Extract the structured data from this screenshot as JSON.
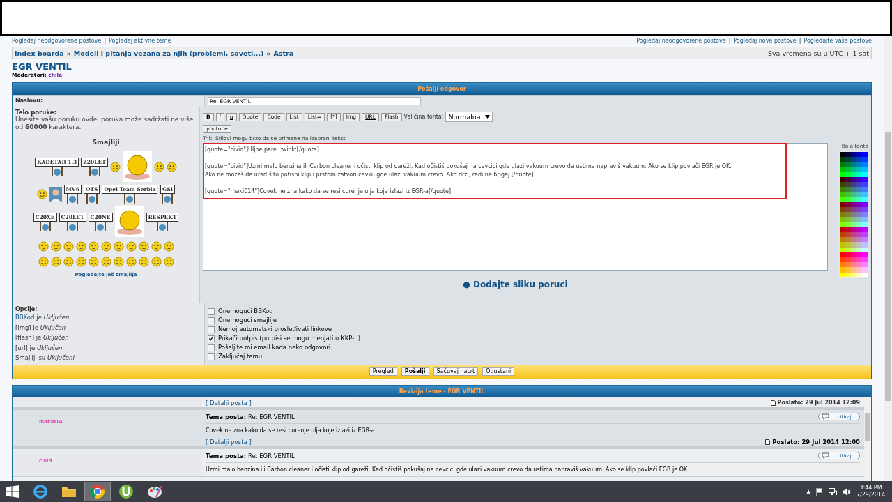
{
  "top_links": {
    "sep": "|",
    "left": [
      "Pogledaj neodgovorene postove",
      "Pogledaj aktivne teme"
    ],
    "right": [
      "Pogledaj neodgovorene postove",
      "Pogledaj nove postove",
      "Pogledajte vaše postove"
    ]
  },
  "breadcrumbs": [
    "Index boarda",
    "Modeli i pitanja vezana za njih (problemi, saveti...)",
    "Astra"
  ],
  "breadcrumb_sep": "»",
  "timezone": "Sva vremena su u UTC + 1 sat",
  "topic": {
    "title": "EGR VENTIL",
    "moderator_label": "Moderatori:",
    "moderator": "chile"
  },
  "form": {
    "header": "Pošalji odgovor",
    "subject_label": "Naslovu:",
    "subject": "Re: EGR VENTIL",
    "body_label": "Telo poruke:",
    "body_hint": "Unesite vašu poruku ovde, poruka može sadržati ne više od **60000** karaktera.",
    "smilies_title": "Smajliji",
    "more_smilies": "Pogledajte još smajlija",
    "smilies": [
      [
        {
          "kind": "sign",
          "label": "KADETAR 1.3"
        },
        {
          "kind": "sign",
          "label": "Z20LET"
        },
        {
          "kind": "smiley"
        },
        {
          "kind": "big"
        },
        {
          "kind": "smiley"
        },
        {
          "kind": "smiley"
        }
      ],
      [
        {
          "kind": "smiley"
        },
        {
          "kind": "figure"
        },
        {
          "kind": "sign",
          "label": "MV6"
        },
        {
          "kind": "sign",
          "label": "OTS"
        },
        {
          "kind": "sign",
          "label": "Opel Team Serbia"
        },
        {
          "kind": "sign",
          "label": "GSi"
        }
      ],
      [
        {
          "kind": "sign",
          "label": "C20XE"
        },
        {
          "kind": "sign",
          "label": "C20LET"
        },
        {
          "kind": "sign",
          "label": "C20NE"
        },
        {
          "kind": "big"
        },
        {
          "kind": "sign",
          "label": "RESPEKT"
        }
      ],
      [
        {
          "kind": "smiley"
        },
        {
          "kind": "smiley"
        },
        {
          "kind": "smiley"
        },
        {
          "kind": "smiley"
        },
        {
          "kind": "smiley"
        },
        {
          "kind": "smiley"
        },
        {
          "kind": "smiley"
        },
        {
          "kind": "smiley"
        },
        {
          "kind": "smiley"
        },
        {
          "kind": "smiley"
        },
        {
          "kind": "smiley"
        }
      ],
      [
        {
          "kind": "smiley"
        },
        {
          "kind": "smiley"
        },
        {
          "kind": "smiley"
        },
        {
          "kind": "smiley"
        },
        {
          "kind": "smiley"
        },
        {
          "kind": "smiley"
        },
        {
          "kind": "smiley"
        },
        {
          "kind": "smiley"
        },
        {
          "kind": "smiley"
        },
        {
          "kind": "smiley"
        },
        {
          "kind": "smiley"
        }
      ]
    ],
    "toolbar": [
      "B",
      "i",
      "u",
      "Quote",
      "Code",
      "List",
      "List=",
      "[*]",
      "Img",
      "URL",
      "Flash"
    ],
    "font_size_label": "Veličina fonta:",
    "font_size": "Normalna",
    "toolbar2": [
      "youtube"
    ],
    "tip": "Trik: Stilovi mogu brzo da se primene na izabrani tekst",
    "message_paragraphs": [
      [
        "[quote=\"civid\"]Uljne pare. :wink:[/quote]"
      ],
      [
        "[quote=\"civid\"]Uzmi malo benzina ili Carbon cleaner i očisti klip od gareži. Kad očistiš pokušaj na cevcici gde ulazi vakuum crevo da ustima napraviš vakuum. Ako se klip povlači EGR je OK.",
        "Ako ne možeš da uradiš to potisni klip i prstom zatvori cevku gde ulazi vakuum crevo. Ako drži, radi ne brigaj.[/quote]"
      ],
      [
        "[quote=\"maki014\"]Covek ne zna kako da se resi curenje ulja koje izlazi iz EGR-a[/quote]"
      ]
    ],
    "font_color_label": "Boja fonta",
    "add_image": "● Dodajte sliku poruci",
    "options_label": "Opcije:",
    "options_status": [
      {
        "link": "BBKod",
        "text": "je *Uključen*"
      },
      {
        "text": "[img] je *Uključen*"
      },
      {
        "text": "[flash] je *Uključen*"
      },
      {
        "text": "[url] je *Uključen*"
      },
      {
        "text": "Smajliji su *Uključeni*"
      }
    ],
    "checkboxes": [
      {
        "label": "Onemogući BBKod",
        "checked": false
      },
      {
        "label": "Onemogući smajlije",
        "checked": false
      },
      {
        "label": "Nemoj automatski prosleđivati linkove",
        "checked": false
      },
      {
        "label": "Prikači potpis (potpisi se mogu menjati u KKP-u)",
        "checked": true
      },
      {
        "label": "Pošaljite mi email kada neko odgovori",
        "checked": false
      },
      {
        "label": "Zaključaj temu",
        "checked": false
      }
    ],
    "buttons": [
      {
        "label": "Pregled",
        "kind": "normal"
      },
      {
        "label": "Pošalji",
        "kind": "primary"
      },
      {
        "label": "Sačuvaj nacrt",
        "kind": "normal"
      },
      {
        "label": "Odustani",
        "kind": "normal"
      }
    ]
  },
  "review": {
    "header": "Revizija teme - EGR VENTIL",
    "partial": {
      "details": "[ Detalji posta ]",
      "posted_label": "Poslato:",
      "posted": "29 Jul 2014 12:09"
    },
    "posts": [
      {
        "author": "maki014",
        "subject_label": "Tema posta:",
        "subject": "Re: EGR VENTIL",
        "quote": "citiraj",
        "body": [
          "Covek ne zna kako da se resi curenje ulja koje izlazi iz EGR-a"
        ],
        "details": "[ Detalji posta ]",
        "posted_label": "Poslato:",
        "posted": "29 Jul 2014 12:00"
      },
      {
        "author": "civid",
        "subject_label": "Tema posta:",
        "subject": "Re: EGR VENTIL",
        "quote": "citiraj",
        "body": [
          "Uzmi malo benzina ili Carbon cleaner i očisti klip od gareži. Kad očistiš pokušaj na cevcici gde ulazi vakuum crevo da ustima napraviš vakuum. Ako se klip povlači EGR je OK."
        ]
      }
    ]
  },
  "taskbar": {
    "apps": [
      {
        "kind": "ie",
        "selected": false
      },
      {
        "kind": "folder",
        "selected": false
      },
      {
        "kind": "chrome",
        "selected": true
      },
      {
        "kind": "torrent",
        "selected": false
      },
      {
        "kind": "paint",
        "selected": false
      }
    ],
    "tray_arrow": "▲",
    "time": "3:44 PM",
    "date": "7/29/2014"
  }
}
